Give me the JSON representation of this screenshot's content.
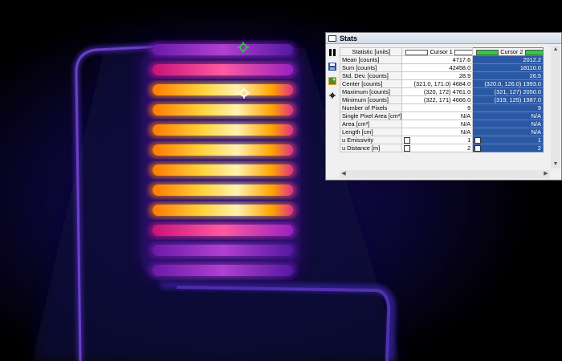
{
  "image": {
    "colormap": "ironbow"
  },
  "cursors": [
    {
      "name": "Cursor 1",
      "color": "#ffffff"
    },
    {
      "name": "Cursor 2",
      "color": "#2ecc40"
    }
  ],
  "stats_window": {
    "title": "Stats",
    "icons": [
      "pause-icon",
      "save-icon",
      "image-icon",
      "cursor-icon"
    ],
    "header": {
      "statistic": "Statistic [units]",
      "cursor1": "Cursor 1",
      "cursor2": "Cursor 2"
    },
    "rows": [
      {
        "label": "Mean [counts]",
        "c1": "4717.6",
        "c2": "2012.2"
      },
      {
        "label": "Sum [counts]",
        "c1": "42458.0",
        "c2": "18110.0"
      },
      {
        "label": "Std. Dev. [counts]",
        "c1": "28.9",
        "c2": "26.5"
      },
      {
        "label": "Center [counts]",
        "c1": "(321.0, 171.0) 4684.0",
        "c2": "(320.0, 126.0) 1993.0"
      },
      {
        "label": "Maximum [counts]",
        "c1": "(320, 172) 4761.0",
        "c2": "(321, 127) 2050.0"
      },
      {
        "label": "Minimum [counts]",
        "c1": "(322, 171) 4666.0",
        "c2": "(319, 125) 1987.0"
      },
      {
        "label": "Number of Pixels",
        "c1": "9",
        "c2": "9"
      },
      {
        "label": "Single Pixel Area [cm²]",
        "c1": "N/A",
        "c2": "N/A"
      },
      {
        "label": "Area [cm²]",
        "c1": "N/A",
        "c2": "N/A"
      },
      {
        "label": "Length [cm]",
        "c1": "N/A",
        "c2": "N/A"
      },
      {
        "label": "u   Emissivity",
        "c1": "1",
        "c2": "1",
        "checkbox": true
      },
      {
        "label": "u   Distance [m]",
        "c1": "2",
        "c2": "2",
        "checkbox": true
      }
    ]
  }
}
